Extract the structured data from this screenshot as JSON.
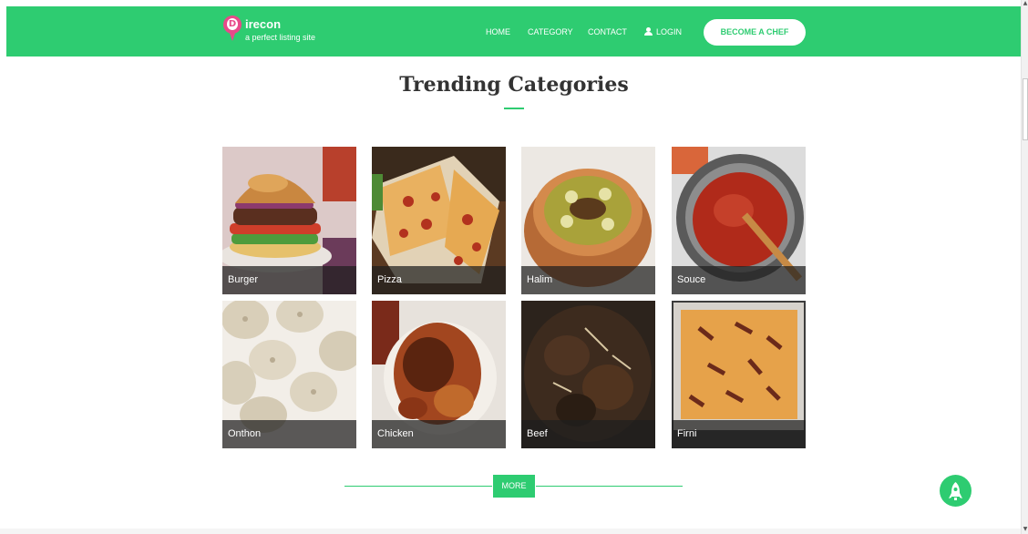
{
  "brand": {
    "logo_letter": "D",
    "name": "irecon",
    "tagline": "a perfect listing site",
    "colors": {
      "primary": "#2ecc71",
      "pin": "#e84a8a"
    }
  },
  "nav": {
    "home": "HOME",
    "category": "CATEGORY",
    "contact": "CONTACT",
    "login": "LOGIN",
    "login_icon": "user-icon",
    "become_chef": "BECOME A CHEF"
  },
  "section": {
    "title": "Trending Categories"
  },
  "categories": [
    {
      "name": "Burger",
      "image": "burger-photo"
    },
    {
      "name": "Pizza",
      "image": "pizza-photo"
    },
    {
      "name": "Halim",
      "image": "halim-photo"
    },
    {
      "name": "Souce",
      "image": "sauce-photo"
    },
    {
      "name": "Onthon",
      "image": "dumplings-photo"
    },
    {
      "name": "Chicken",
      "image": "roast-chicken-photo"
    },
    {
      "name": "Beef",
      "image": "beef-photo"
    },
    {
      "name": "Firni",
      "image": "firni-photo"
    }
  ],
  "more_button": "MORE",
  "scroll_top_icon": "rocket-icon"
}
